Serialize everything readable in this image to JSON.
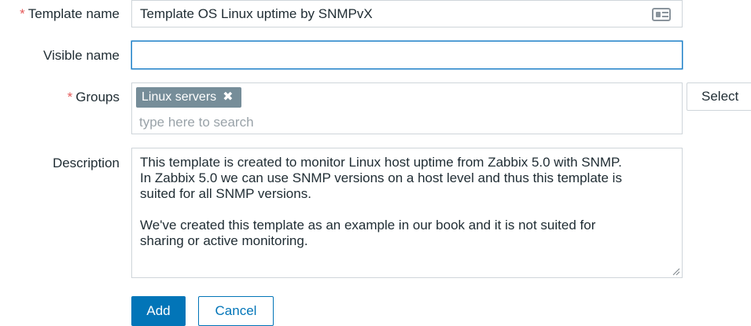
{
  "form": {
    "template_name": {
      "label": "Template name",
      "required_mark": "*",
      "value": "Template OS Linux uptime by SNMPvX",
      "icon": "card-icon"
    },
    "visible_name": {
      "label": "Visible name",
      "value": ""
    },
    "groups": {
      "label": "Groups",
      "required_mark": "*",
      "tags": [
        {
          "label": "Linux servers",
          "remove_symbol": "✖"
        }
      ],
      "search_placeholder": "type here to search",
      "select_label": "Select"
    },
    "description": {
      "label": "Description",
      "value": "This template is created to monitor Linux host uptime from Zabbix 5.0 with SNMP.\nIn Zabbix 5.0 we can use SNMP versions on a host level and thus this template is\nsuited for all SNMP versions.\n\nWe've created this template as an example in our book and it is not suited for\nsharing or active monitoring."
    }
  },
  "actions": {
    "add_label": "Add",
    "cancel_label": "Cancel"
  },
  "colors": {
    "primary": "#0275b8",
    "required": "#e45959",
    "tag_bg": "#768d99",
    "focus_border": "#1e80c8"
  }
}
